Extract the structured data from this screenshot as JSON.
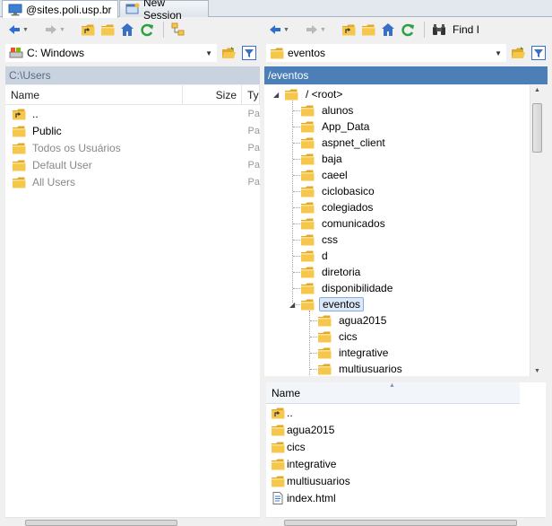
{
  "tabs": [
    {
      "label": "@sites.poli.usp.br",
      "icon": "monitor-icon",
      "active": true
    },
    {
      "label": "New Session",
      "icon": "new-session-icon",
      "active": false
    }
  ],
  "toolbar_right": {
    "find_label": "Find I"
  },
  "left_panel": {
    "drive": "C: Windows",
    "path": "C:\\Users",
    "columns": {
      "name": "Name",
      "size": "Size",
      "type": "Ty"
    },
    "files": [
      {
        "name": "..",
        "type": "Pa",
        "icon": "parent-folder-icon",
        "dim": false
      },
      {
        "name": "Public",
        "type": "Pa",
        "icon": "folder-icon",
        "dim": false
      },
      {
        "name": "Todos os Usuários",
        "type": "Pa",
        "icon": "folder-icon",
        "dim": true
      },
      {
        "name": "Default User",
        "type": "Pa",
        "icon": "folder-icon",
        "dim": true
      },
      {
        "name": "All Users",
        "type": "Pa",
        "icon": "folder-icon",
        "dim": true
      }
    ]
  },
  "right_panel": {
    "folder": "eventos",
    "path": "/eventos",
    "tree": {
      "root": "/ <root>",
      "folders": [
        "alunos",
        "App_Data",
        "aspnet_client",
        "baja",
        "caeel",
        "ciclobasico",
        "colegiados",
        "comunicados",
        "css",
        "d",
        "diretoria",
        "disponibilidade",
        "eventos"
      ],
      "selected": "eventos",
      "children": [
        "agua2015",
        "cics",
        "integrative",
        "multiusuarios"
      ]
    },
    "list_header": "Name",
    "files": [
      {
        "name": "..",
        "icon": "parent-folder-icon"
      },
      {
        "name": "agua2015",
        "icon": "folder-icon"
      },
      {
        "name": "cics",
        "icon": "folder-icon"
      },
      {
        "name": "integrative",
        "icon": "folder-icon"
      },
      {
        "name": "multiusuarios",
        "icon": "folder-icon"
      },
      {
        "name": "index.html",
        "icon": "html-file-icon"
      }
    ]
  },
  "colors": {
    "folder": "#e8b33b",
    "accent": "#4c7fb8",
    "selection": "#dbe8f8"
  }
}
